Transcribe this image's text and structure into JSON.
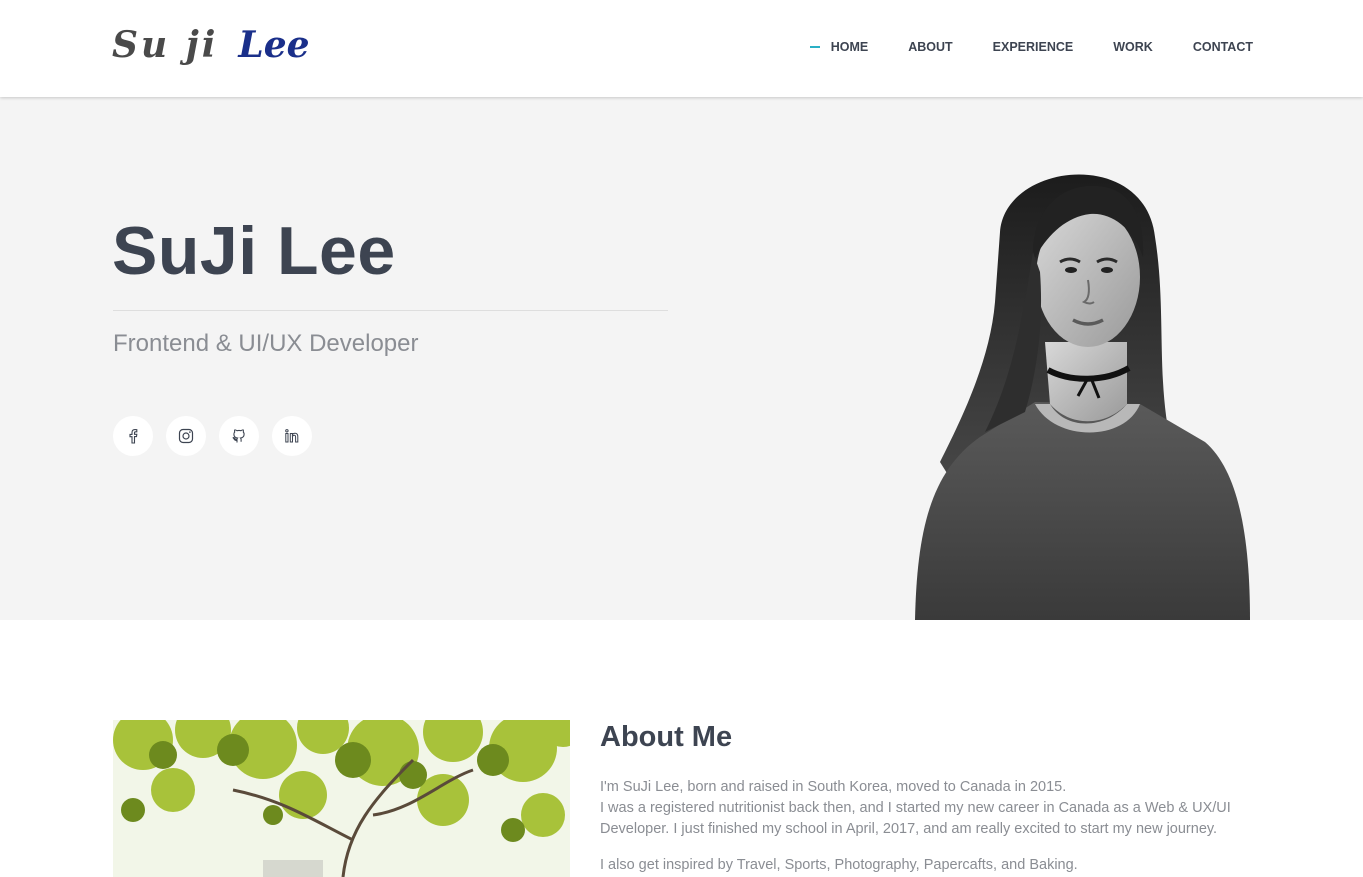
{
  "logo": {
    "first": "Su ji",
    "last": "Lee"
  },
  "nav": {
    "items": [
      {
        "label": "HOME",
        "active": true
      },
      {
        "label": "ABOUT"
      },
      {
        "label": "EXPERIENCE"
      },
      {
        "label": "WORK"
      },
      {
        "label": "CONTACT"
      }
    ]
  },
  "hero": {
    "name": "SuJi Lee",
    "subtitle": "Frontend & UI/UX Developer",
    "socials": [
      {
        "icon": "facebook-icon"
      },
      {
        "icon": "instagram-icon"
      },
      {
        "icon": "github-icon"
      },
      {
        "icon": "linkedin-icon"
      }
    ]
  },
  "about": {
    "title": "About Me",
    "line1": "I'm SuJi Lee, born and raised in South Korea, moved to Canada in 2015.",
    "line2": "I was a registered nutritionist back then, and I started my new career in Canada as a Web & UX/UI Developer. I just finished my school in April, 2017, and am really excited to start my new journey.",
    "line3": "I also get inspired by Travel, Sports, Photography, Papercafts, and Baking."
  },
  "colors": {
    "accent": "#2ab0c5",
    "logo_blue": "#1a2f8a",
    "heading": "#3d4451",
    "hero_bg": "#f4f4f4"
  }
}
